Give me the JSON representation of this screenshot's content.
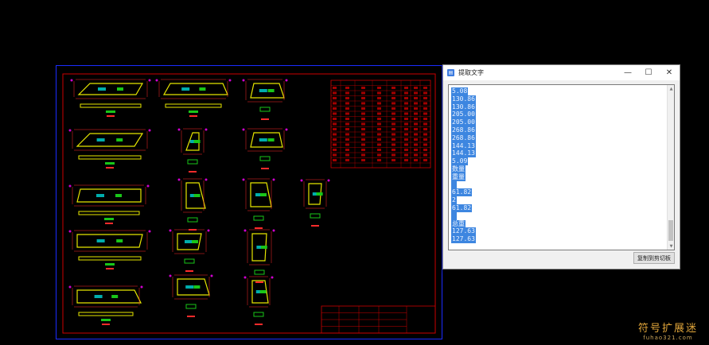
{
  "dialog": {
    "title": "提取文字",
    "minimize_glyph": "—",
    "maximize_glyph": "☐",
    "close_glyph": "✕",
    "copy_button": "复制到剪切板",
    "lines": [
      "5.08",
      "130.86",
      "130.86",
      "205.00",
      "205.00",
      "268.86",
      "268.86",
      "144.13",
      "144.13",
      "5.09",
      "数量",
      "重量",
      "",
      "61.82",
      "2",
      "61.82",
      "",
      "总重",
      "127.63",
      "127.63"
    ]
  },
  "cad": {
    "colors": {
      "frame": "#cc0000",
      "part": "#e6e600",
      "dim": "#ff2b2b",
      "label": "#19c619",
      "text": "#ffffff",
      "cyan": "#00d8d8",
      "magenta": "#d000d0"
    },
    "table_title": "材料表"
  },
  "watermark": {
    "cn": "符号扩展迷",
    "en": "fuhao321.com"
  }
}
